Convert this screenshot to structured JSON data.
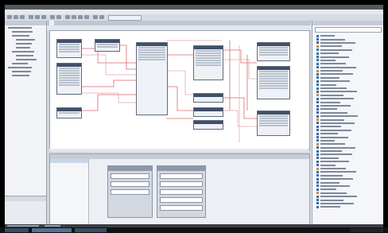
{
  "app": {
    "title": "",
    "brand": ""
  },
  "menu": [],
  "editor": {
    "tab_label": ""
  },
  "project_tree": {
    "header": "",
    "items": [
      {
        "depth": 0,
        "w": 30
      },
      {
        "depth": 1,
        "w": 26
      },
      {
        "depth": 1,
        "w": 22
      },
      {
        "depth": 2,
        "w": 24
      },
      {
        "depth": 2,
        "w": 20
      },
      {
        "depth": 2,
        "w": 18
      },
      {
        "depth": 1,
        "w": 28
      },
      {
        "depth": 2,
        "w": 22
      },
      {
        "depth": 2,
        "w": 26
      },
      {
        "depth": 1,
        "w": 20
      },
      {
        "depth": 0,
        "w": 30
      },
      {
        "depth": 1,
        "w": 24
      },
      {
        "depth": 1,
        "w": 22
      }
    ]
  },
  "properties": {
    "header": "",
    "groups": [
      {
        "header": "",
        "fields": 3
      },
      {
        "header": "",
        "fields": 5
      }
    ]
  },
  "library": {
    "header": "",
    "items": 50
  },
  "colors": {
    "block_header": "#41506a",
    "wire_red": "#d66a6a",
    "wire_pink": "#e8a8b0",
    "accent": "#3a6ea5"
  }
}
